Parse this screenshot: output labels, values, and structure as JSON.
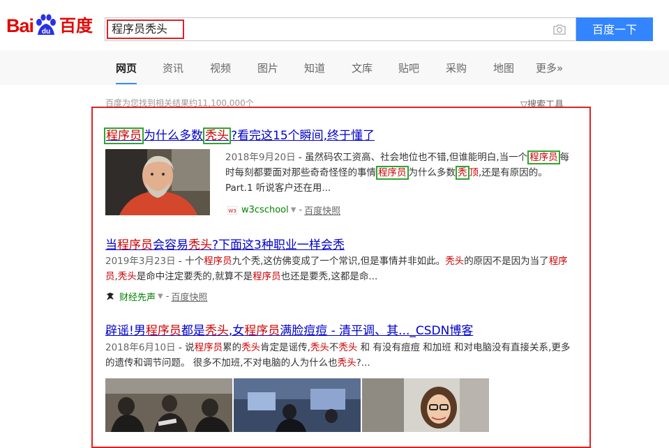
{
  "logo": {
    "part1": "Bai",
    "du": "du",
    "part2": "百度"
  },
  "search": {
    "query": "程序员秃头",
    "button_label": "百度一下"
  },
  "tabs": [
    "网页",
    "资讯",
    "视频",
    "图片",
    "知道",
    "文库",
    "贴吧",
    "采购",
    "地图",
    "更多»"
  ],
  "stats": "百度为您找到相关结果约11,100,000个",
  "tools_label": "▽搜索工具",
  "results": [
    {
      "title": {
        "t1": "程序员",
        "t2": "为什么多数",
        "t3": "秃头",
        "t4": "?看完这15个瞬间,终于懂了"
      },
      "date": "2018年9月20日",
      "abs": {
        "a1": " - 虽然码农工资高、社会地位也不错,但谁能明白,当一个",
        "a2": "程序员",
        "a3": "每时每刻都要面对那些奇奇怪怪的事情",
        "a4": "程序员",
        "a5": "为什么多数",
        "a6": "秃",
        "a7": "顶",
        "a8": ",还是有原因的。 Part.1 听说客户还在用..."
      },
      "source": "w3cschool",
      "snapshot": "百度快照"
    },
    {
      "title": {
        "t1": "当",
        "t2": "程序员",
        "t3": "会容易",
        "t4": "秃头",
        "t5": "?下面这3种职业一样会秃"
      },
      "date": "2019年3月23日",
      "abs": {
        "a1": " - 十个",
        "a2": "程序员",
        "a3": "九个秃,这仿佛变成了一个常识,但是事情并非如此。",
        "a4": "秃头",
        "a5": "的原因不是因为当了",
        "a6": "程序员",
        "a7": ",",
        "a8": "秃头",
        "a9": "是命中注定要秃的,就算不是",
        "a10": "程序员",
        "a11": "也还是要秃,这都是命..."
      },
      "source": "财经先声",
      "snapshot": "百度快照"
    },
    {
      "title": {
        "t1": "辟谣!男",
        "t2": "程序员",
        "t3": "都是",
        "t4": "秃头",
        "t5": ",女",
        "t6": "程序员",
        "t7": "满脸痘痘 - 清平调、其..._CSDN博客"
      },
      "date": "2018年6月10日",
      "abs": {
        "a1": " - 说",
        "a2": "程序员",
        "a3": "累的",
        "a4": "秃头",
        "a5": "肯定是谣传,",
        "a6": "秃头",
        "a7": "不",
        "a8": "秃头",
        "a9": " 和 有没有痘痘 和加班 和对电脑没有直接关系,更多的遗传和调节问题。 很多不加班,不对电脑的人为什么也",
        "a10": "秃头",
        "a11": "?..."
      }
    }
  ],
  "colors": {
    "brand_red": "#e10602",
    "button_blue": "#3385ff",
    "link_blue": "#0000cc",
    "keyword_red": "#cc0000",
    "source_green": "#008000",
    "annotation_red": "#e02020",
    "annotation_green": "#2ea52e"
  }
}
